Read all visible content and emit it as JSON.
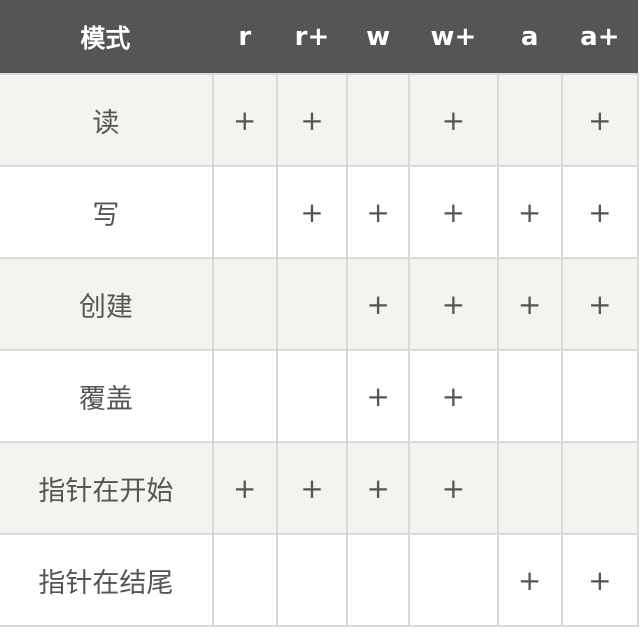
{
  "header": {
    "label": "模式",
    "modes": [
      "r",
      "r+",
      "w",
      "w+",
      "a",
      "a+"
    ]
  },
  "rows": [
    {
      "label": "读",
      "cells": [
        "+",
        "+",
        "",
        "+",
        "",
        "+"
      ]
    },
    {
      "label": "写",
      "cells": [
        "",
        "+",
        "+",
        "+",
        "+",
        "+"
      ]
    },
    {
      "label": "创建",
      "cells": [
        "",
        "",
        "+",
        "+",
        "+",
        "+"
      ]
    },
    {
      "label": "覆盖",
      "cells": [
        "",
        "",
        "+",
        "+",
        "",
        ""
      ]
    },
    {
      "label": "指针在开始",
      "cells": [
        "+",
        "+",
        "+",
        "+",
        "",
        ""
      ]
    },
    {
      "label": "指针在结尾",
      "cells": [
        "",
        "",
        "",
        "",
        "+",
        "+"
      ]
    }
  ]
}
